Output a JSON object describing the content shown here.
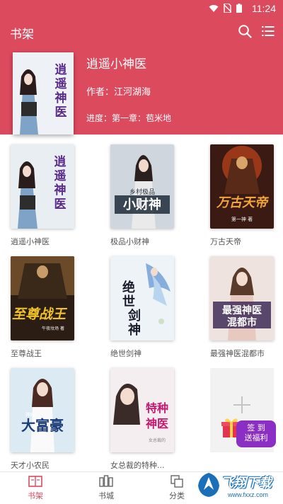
{
  "status": {
    "time": "11:24"
  },
  "header": {
    "title": "书架"
  },
  "current_book": {
    "title": "逍遥小神医",
    "author_line": "作者：江河湖海",
    "progress_line": "进度：第一章：苞米地",
    "cover_text": "逍遥神医"
  },
  "books": [
    {
      "title": "逍遥小神医",
      "cover_text": "逍遥神医",
      "bg": "#e9eef3",
      "fg": "#5a2b8a"
    },
    {
      "title": "极品小财神",
      "cover_text": "小财神",
      "bg": "#cfd6dd",
      "fg": "#1f2c3a"
    },
    {
      "title": "万古天帝",
      "cover_text": "万古天帝",
      "bg": "#3a1a12",
      "fg": "#f1a53a"
    },
    {
      "title": "至尊战王",
      "cover_text": "至尊战王",
      "bg": "#2b1d14",
      "fg": "#f0c22a"
    },
    {
      "title": "绝世剑神",
      "cover_text": "绝世剑神",
      "bg": "#eef3f8",
      "fg": "#1b1b2a"
    },
    {
      "title": "最强神医混都市",
      "cover_text": "最强神医混都市",
      "bg": "#efe3e0",
      "fg": "#3e2c57"
    },
    {
      "title": "天才小农民",
      "cover_text": "大富豪",
      "bg": "#dcebf3",
      "fg": "#1d3d7a"
    },
    {
      "title": "女总裁的特种...",
      "cover_text": "特种神医",
      "bg": "#f5eef1",
      "fg": "#c6166f"
    }
  ],
  "promo": {
    "line1": "签 到",
    "line2": "送福利"
  },
  "tabs": [
    {
      "label": "书架"
    },
    {
      "label": "书城"
    },
    {
      "label": "分类"
    }
  ],
  "watermark": {
    "brand": "飞翔下载",
    "url": "www.fxxz.com"
  },
  "colors": {
    "brand": "#dc4a5e",
    "active_tab": "#dc4a5e"
  }
}
